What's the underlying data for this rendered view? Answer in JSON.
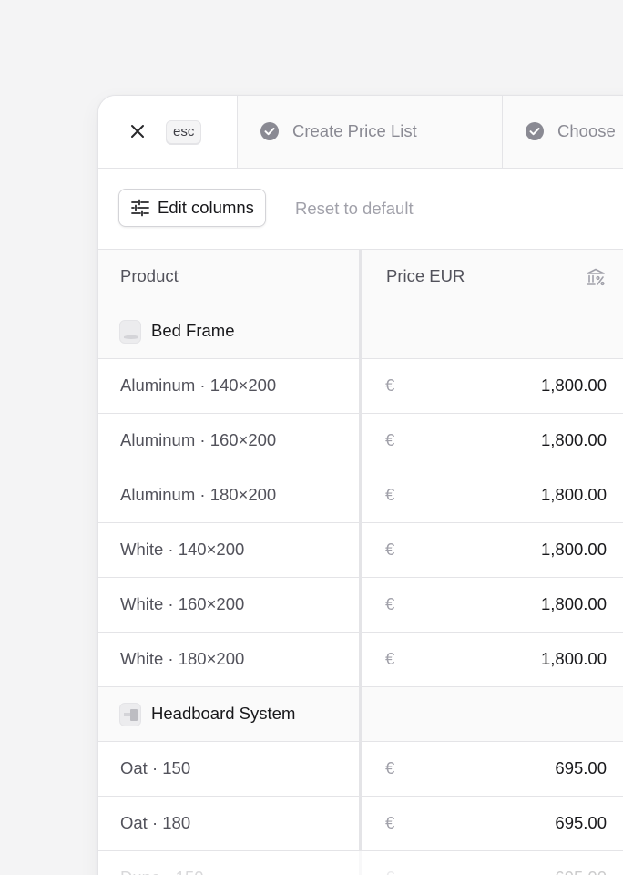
{
  "header": {
    "close_kbd": "esc",
    "steps": [
      {
        "label": "Create Price List"
      },
      {
        "label": "Choose"
      }
    ]
  },
  "toolbar": {
    "edit_columns_label": "Edit columns",
    "reset_label": "Reset to default"
  },
  "table": {
    "columns": [
      "Product",
      "Price EUR"
    ],
    "currency_symbol": "€",
    "groups": [
      {
        "name": "Bed Frame",
        "rows": [
          {
            "variant": "Aluminum · 140×200",
            "price": "1,800.00"
          },
          {
            "variant": "Aluminum · 160×200",
            "price": "1,800.00"
          },
          {
            "variant": "Aluminum · 180×200",
            "price": "1,800.00"
          },
          {
            "variant": "White · 140×200",
            "price": "1,800.00"
          },
          {
            "variant": "White · 160×200",
            "price": "1,800.00"
          },
          {
            "variant": "White · 180×200",
            "price": "1,800.00"
          }
        ]
      },
      {
        "name": "Headboard System",
        "rows": [
          {
            "variant": "Oat · 150",
            "price": "695.00"
          },
          {
            "variant": "Oat · 180",
            "price": "695.00"
          },
          {
            "variant": "Dune · 150",
            "price": "695.00"
          }
        ]
      }
    ]
  },
  "icons": {
    "close": "close-icon",
    "step_done": "check-circle-icon",
    "edit_columns": "sliders-icon",
    "price_column": "bank-percent-icon"
  },
  "colors": {
    "panel_bg": "#ffffff",
    "page_bg": "#f4f4f5",
    "border": "#e4e4e7",
    "muted_text": "#a1a1aa",
    "check_fill": "#8a8a93"
  }
}
